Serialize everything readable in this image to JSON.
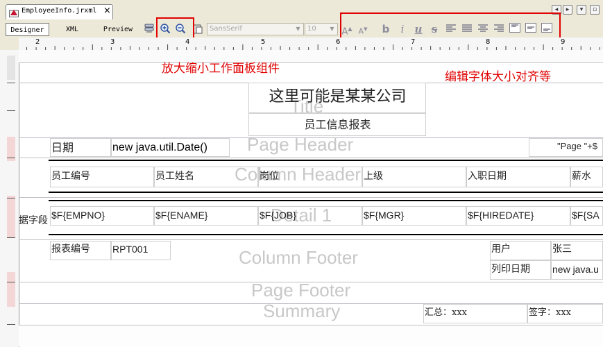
{
  "tab": {
    "label": "EmployeeInfo.jrxml",
    "close": "×"
  },
  "toolbar": {
    "modes": [
      "Designer",
      "XML",
      "Preview"
    ],
    "font_name": "SansSerif",
    "font_size": "10"
  },
  "ruler": {
    "labels": [
      "2",
      "3",
      "4",
      "5",
      "6",
      "7",
      "8",
      "9"
    ]
  },
  "annotations": {
    "zoom_note": "放大缩小工作面板组件",
    "font_note": "编辑字体大小对齐等"
  },
  "bands": {
    "title": "Title",
    "page_header": "Page Header",
    "column_header": "Column Header",
    "detail": "Detail 1",
    "column_footer": "Column Footer",
    "page_footer": "Page Footer",
    "summary": "Summary"
  },
  "title": {
    "company": "这里可能是某某公司",
    "subtitle": "员工信息报表"
  },
  "page_header": {
    "date_label": "日期",
    "date_expr": "new java.util.Date()",
    "page_expr": "\"Page \"+$"
  },
  "columns": [
    "员工编号",
    "员工姓名",
    "岗位",
    "上级",
    "入职日期",
    "薪水"
  ],
  "detail": {
    "row_label": "据字段",
    "fields": [
      "$F{EMPNO}",
      "$F{ENAME}",
      "$F{JOB}",
      "$F{MGR}",
      "$F{HIREDATE}",
      "$F{SA"
    ]
  },
  "column_footer": {
    "report_no_label": "报表编号",
    "report_no": "RPT001",
    "user_label": "用户",
    "user": "张三",
    "print_date_label": "列印日期",
    "print_date": "new java.u"
  },
  "summary": {
    "total": "汇总：xxx",
    "sign": "签字：xxx"
  },
  "colors": {
    "annotation_red": "#e00000",
    "toolbar_bg": "#ece9d8"
  }
}
